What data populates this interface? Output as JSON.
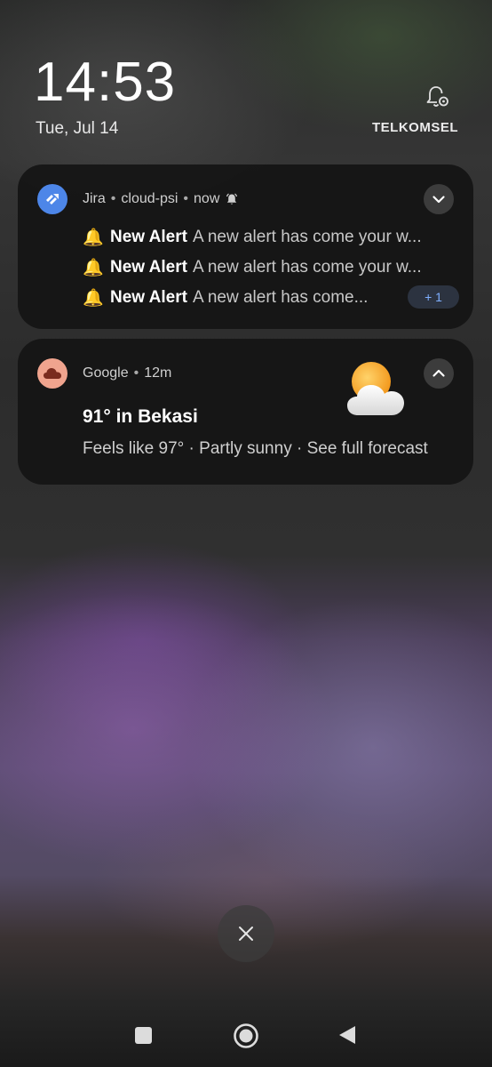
{
  "status": {
    "time": "14:53",
    "date": "Tue, Jul 14",
    "carrier": "TELKOMSEL",
    "settings_icon": "bell-settings-icon"
  },
  "notifications": {
    "jira": {
      "app": "Jira",
      "account": "cloud-psi",
      "when": "now",
      "alert_icon": "alarm-bell-icon",
      "rows": [
        {
          "emoji": "🔔",
          "title": "New Alert",
          "body": "A new alert has come your w..."
        },
        {
          "emoji": "🔔",
          "title": "New Alert",
          "body": "A new alert has come your w..."
        },
        {
          "emoji": "🔔",
          "title": "New Alert",
          "body": "A new alert has come..."
        }
      ],
      "more_count": "+ 1",
      "expanded": false
    },
    "google": {
      "app": "Google",
      "when": "12m",
      "title": "91° in Bekasi",
      "subtitle": "Feels like 97° · Partly sunny · See full forecast",
      "weather_icon": "partly-sunny-icon",
      "expanded": true
    }
  },
  "nav": {
    "recents_icon": "recents-icon",
    "home_icon": "home-icon",
    "back_icon": "back-icon",
    "dismiss_icon": "close-icon"
  },
  "colors": {
    "jira_icon_bg": "#4d86e8",
    "google_icon_bg": "#f0a48e",
    "badge_text": "#7fb0ff",
    "card_bg": "#141414"
  }
}
